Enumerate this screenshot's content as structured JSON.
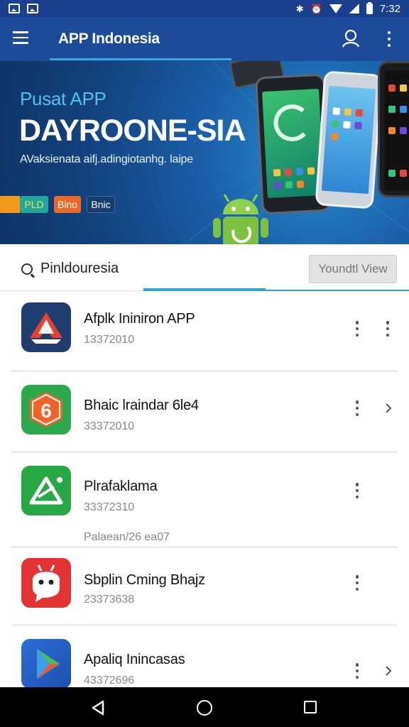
{
  "status_bar": {
    "time": "7:32",
    "icons": [
      "image-icon",
      "image-icon",
      "bluetooth-icon",
      "alarm-icon",
      "wifi-icon",
      "signal-icon",
      "battery-icon"
    ]
  },
  "app_bar": {
    "title": "APP Indonesia",
    "icons": [
      "menu-icon",
      "account-search-icon",
      "more-vert-icon"
    ]
  },
  "banner": {
    "subtitle": "Pusat APP",
    "headline": "DAYROONE-SIA",
    "tagline": "AVaksienata aifj.adingiotanhg. laipe",
    "chips": [
      "PLD",
      "Bino",
      "Bnic"
    ]
  },
  "filter": {
    "label": "Pinldouresia",
    "view_button": "Youndtl View"
  },
  "apps": [
    {
      "name": "Afplk Ininiron APP",
      "meta": "13372010",
      "extra": "",
      "trailing": "more"
    },
    {
      "name": "Bhaic lraindar 6le4",
      "meta": "33372010",
      "extra": "",
      "trailing": "chevron"
    },
    {
      "name": "Plrafaklama",
      "meta": "33372310",
      "extra": "Palaean/26 ea07",
      "trailing": "none"
    },
    {
      "name": "Sbplin Cming Bhajz",
      "meta": "23373638",
      "extra": "",
      "trailing": "none"
    },
    {
      "name": "Apaliq Inincasas",
      "meta": "43372696",
      "extra": "",
      "trailing": "chevron"
    }
  ],
  "colors": {
    "status_bar": "#1a3f8c",
    "app_bar": "#1d4a99",
    "accent": "#2aa6d8"
  },
  "nav_bar": {
    "icons": [
      "back-icon",
      "home-icon",
      "recents-icon"
    ]
  }
}
